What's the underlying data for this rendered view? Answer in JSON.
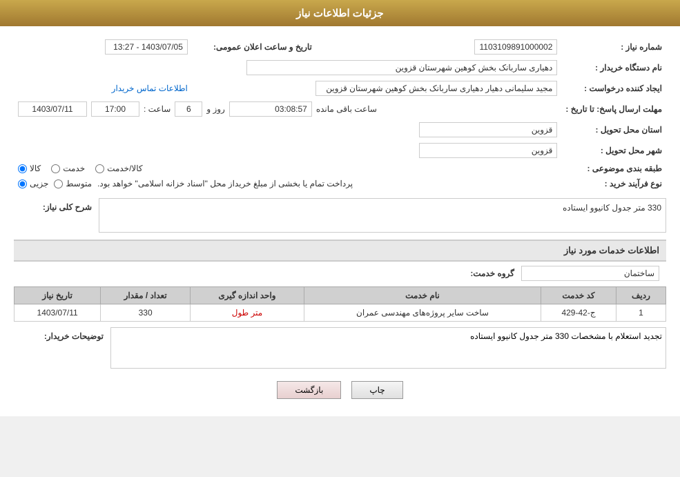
{
  "header": {
    "title": "جزئیات اطلاعات نیاز"
  },
  "fields": {
    "shomara_niaz_label": "شماره نیاز :",
    "shomara_niaz_value": "1103109891000002",
    "name_dastgah_label": "نام دستگاه خریدار :",
    "name_dastgah_value": "دهیاری ساربانک بخش کوهین شهرستان قزوین",
    "ijad_label": "ایجاد کننده درخواست :",
    "ijad_value": "مجید سلیمانی دهیار دهیاری ساربانک بخش کوهین شهرستان قزوین",
    "etelaaat_link": "اطلاعات تماس خریدار",
    "mohlat_label": "مهلت ارسال پاسخ: تا تاریخ :",
    "mohlat_date": "1403/07/11",
    "mohlat_time_label": "ساعت :",
    "mohlat_time": "17:00",
    "mohlat_day_label": "روز و",
    "mohlat_days": "6",
    "mohlat_remaining": "03:08:57",
    "mohlat_remaining_label": "ساعت باقی مانده",
    "ostan_label": "استان محل تحویل :",
    "ostan_value": "قزوین",
    "shahr_label": "شهر محل تحویل :",
    "shahr_value": "قزوین",
    "tabaqe_label": "طبقه بندی موضوعی :",
    "radio_kala": "کالا",
    "radio_khedmat": "خدمت",
    "radio_kala_khedmat": "کالا/خدمت",
    "radio_selected": "kala",
    "nov_label": "نوع فرآیند خرید :",
    "radio_jozi": "جزیی",
    "radio_motavaset": "متوسط",
    "process_text": "پرداخت تمام یا بخشی از مبلغ خریداز محل \"اسناد خزانه اسلامی\" خواهد بود.",
    "sharh_label": "شرح کلی نیاز:",
    "sharh_value": "330 متر جدول کانیوو ایستاده",
    "khadamat_label": "اطلاعات خدمات مورد نیاز",
    "grooh_khadmat_label": "گروه خدمت:",
    "grooh_khadmat_value": "ساختمان",
    "table": {
      "headers": [
        "ردیف",
        "کد خدمت",
        "نام خدمت",
        "واحد اندازه گیری",
        "تعداد / مقدار",
        "تاریخ نیاز"
      ],
      "rows": [
        {
          "radif": "1",
          "kod_khadmat": "ج-42-429",
          "name_khadmat": "ساخت سایر پروژه‌های مهندسی عمران",
          "vahad": "متر طول",
          "tedad": "330",
          "tarikh": "1403/07/11"
        }
      ]
    },
    "buyer_desc_label": "توضیحات خریدار:",
    "buyer_desc_value": "تجدید استعلام با مشخصات 330 متر جدول کانیوو ایستاده",
    "btn_print": "چاپ",
    "btn_back": "بازگشت",
    "tarikh_label": "تاریخ و ساعت اعلان عمومی:",
    "tarikh_value": "1403/07/05 - 13:27"
  }
}
